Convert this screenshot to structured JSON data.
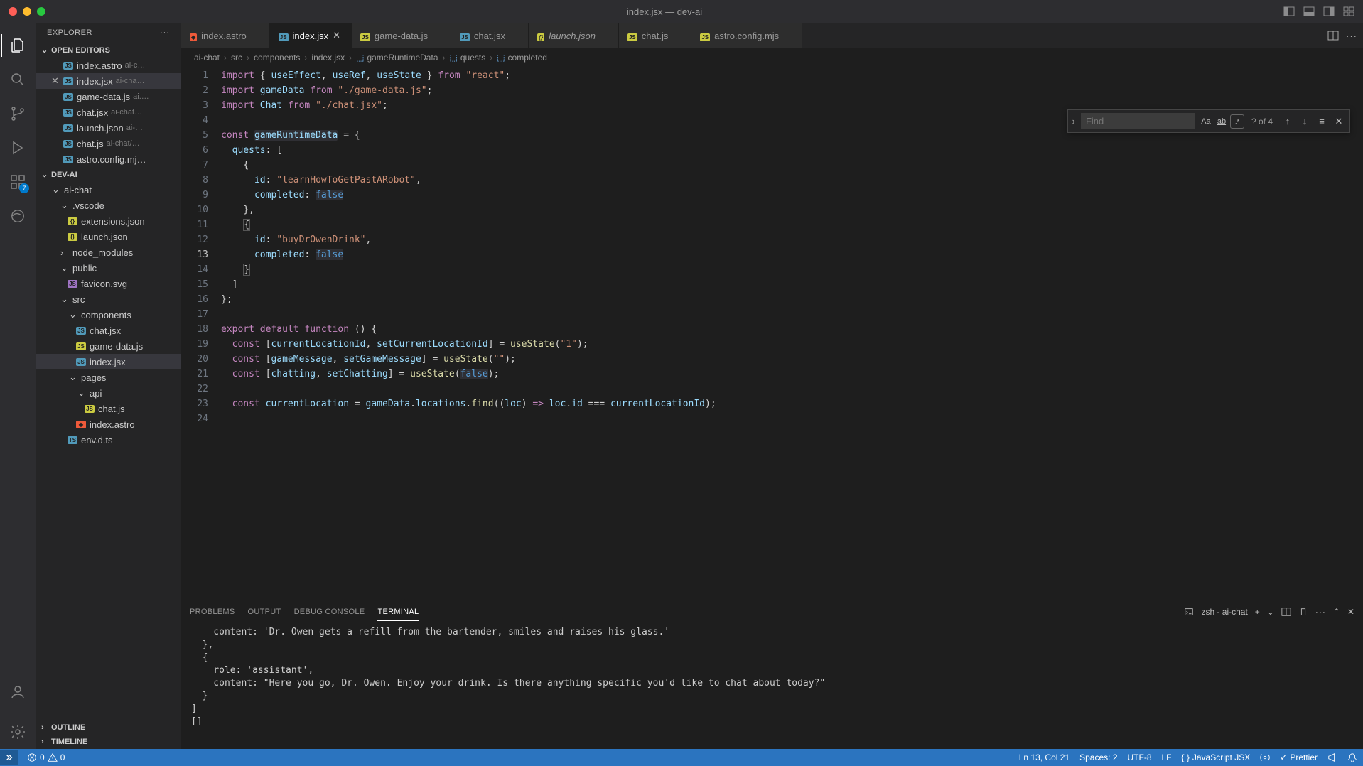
{
  "window": {
    "title": "index.jsx — dev-ai"
  },
  "sidebar": {
    "title": "EXPLORER",
    "sections": {
      "openEditors": {
        "label": "OPEN EDITORS",
        "items": [
          {
            "name": "index.astro",
            "desc": "ai-c…"
          },
          {
            "name": "index.jsx",
            "desc": "ai-cha…",
            "active": true
          },
          {
            "name": "game-data.js",
            "desc": "ai.…"
          },
          {
            "name": "chat.jsx",
            "desc": "ai-chat…"
          },
          {
            "name": "launch.json",
            "desc": "ai-…"
          },
          {
            "name": "chat.js",
            "desc": "ai-chat/…"
          },
          {
            "name": "astro.config.mj…",
            "desc": ""
          }
        ]
      },
      "project": {
        "label": "DEV-AI",
        "tree": [
          {
            "name": "ai-chat",
            "kind": "folder",
            "indent": 1
          },
          {
            "name": ".vscode",
            "kind": "folder",
            "indent": 2
          },
          {
            "name": "extensions.json",
            "kind": "json",
            "indent": 3
          },
          {
            "name": "launch.json",
            "kind": "json",
            "indent": 3
          },
          {
            "name": "node_modules",
            "kind": "folder-closed",
            "indent": 2
          },
          {
            "name": "public",
            "kind": "folder",
            "indent": 2
          },
          {
            "name": "favicon.svg",
            "kind": "svg",
            "indent": 3
          },
          {
            "name": "src",
            "kind": "folder",
            "indent": 2
          },
          {
            "name": "components",
            "kind": "folder",
            "indent": 3
          },
          {
            "name": "chat.jsx",
            "kind": "jsx",
            "indent": 4
          },
          {
            "name": "game-data.js",
            "kind": "js",
            "indent": 4
          },
          {
            "name": "index.jsx",
            "kind": "jsx",
            "indent": 4,
            "active": true
          },
          {
            "name": "pages",
            "kind": "folder",
            "indent": 3
          },
          {
            "name": "api",
            "kind": "folder",
            "indent": 4
          },
          {
            "name": "chat.js",
            "kind": "js",
            "indent": 5
          },
          {
            "name": "index.astro",
            "kind": "astro",
            "indent": 4
          },
          {
            "name": "env.d.ts",
            "kind": "ts",
            "indent": 3
          }
        ]
      },
      "outline": {
        "label": "OUTLINE"
      },
      "timeline": {
        "label": "TIMELINE"
      }
    }
  },
  "activity": {
    "badge": "7"
  },
  "tabs": [
    {
      "label": "index.astro",
      "icon": "astro"
    },
    {
      "label": "index.jsx",
      "icon": "jsx",
      "active": true
    },
    {
      "label": "game-data.js",
      "icon": "js"
    },
    {
      "label": "chat.jsx",
      "icon": "jsx"
    },
    {
      "label": "launch.json",
      "icon": "json",
      "italic": true
    },
    {
      "label": "chat.js",
      "icon": "js"
    },
    {
      "label": "astro.config.mjs",
      "icon": "js"
    }
  ],
  "breadcrumbs": [
    "ai-chat",
    "src",
    "components",
    "index.jsx",
    "gameRuntimeData",
    "quests",
    "completed"
  ],
  "find": {
    "placeholder": "Find",
    "count": "? of 4"
  },
  "editor": {
    "currentLine": 13,
    "lines": 24
  },
  "panel": {
    "tabs": [
      "PROBLEMS",
      "OUTPUT",
      "DEBUG CONSOLE",
      "TERMINAL"
    ],
    "active": "TERMINAL",
    "shell": "zsh - ai-chat",
    "content": "    content: 'Dr. Owen gets a refill from the bartender, smiles and raises his glass.'\n  },\n  {\n    role: 'assistant',\n    content: \"Here you go, Dr. Owen. Enjoy your drink. Is there anything specific you'd like to chat about today?\"\n  }\n]\n[]"
  },
  "status": {
    "errors": "0",
    "warnings": "0",
    "cursor": "Ln 13, Col 21",
    "spaces": "Spaces: 2",
    "encoding": "UTF-8",
    "eol": "LF",
    "language": "JavaScript JSX",
    "prettier": "Prettier"
  }
}
